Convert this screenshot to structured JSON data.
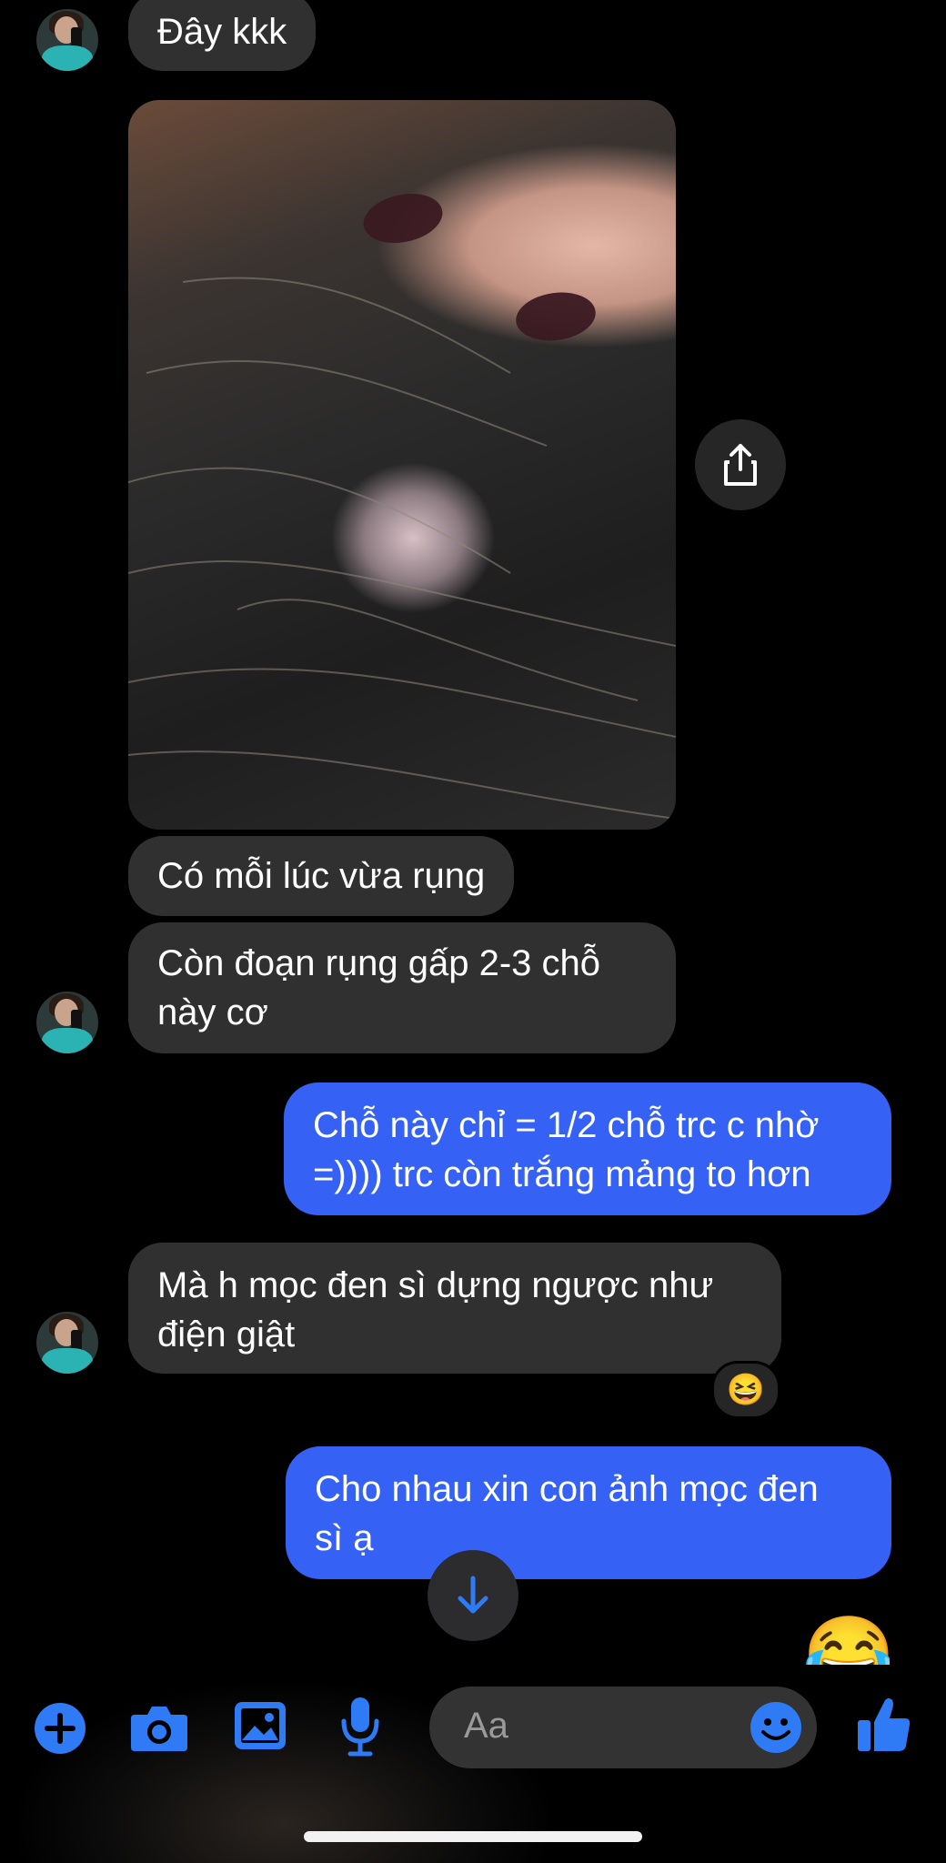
{
  "messages": {
    "m1": "Đây kkk",
    "m2": "Có mỗi lúc vừa rụng",
    "m3_line1": "Còn đoạn rụng gấp 2-3 chỗ",
    "m3_line2": "này cơ",
    "m4_line1": "Chỗ này chỉ = 1/2 chỗ trc c nhờ",
    "m4_line2": "=)))) trc còn trắng mảng to hơn",
    "m5_line1": "Mà h mọc đen sì dựng ngược như",
    "m5_line2": "điện giật",
    "m6_line1": "Cho nhau xin con ảnh mọc đen",
    "m6_line2": "sì ạ"
  },
  "reaction": "😆",
  "last_sent_emoji": "😂",
  "composer": {
    "placeholder": "Aa"
  },
  "colors": {
    "accent": "#2f7bf6",
    "outgoing": "#3562f5",
    "incoming": "#303030"
  },
  "icons": [
    "share-icon",
    "scroll-down-icon",
    "plus-icon",
    "camera-icon",
    "image-icon",
    "microphone-icon",
    "emoji-icon",
    "thumbs-up-icon"
  ]
}
